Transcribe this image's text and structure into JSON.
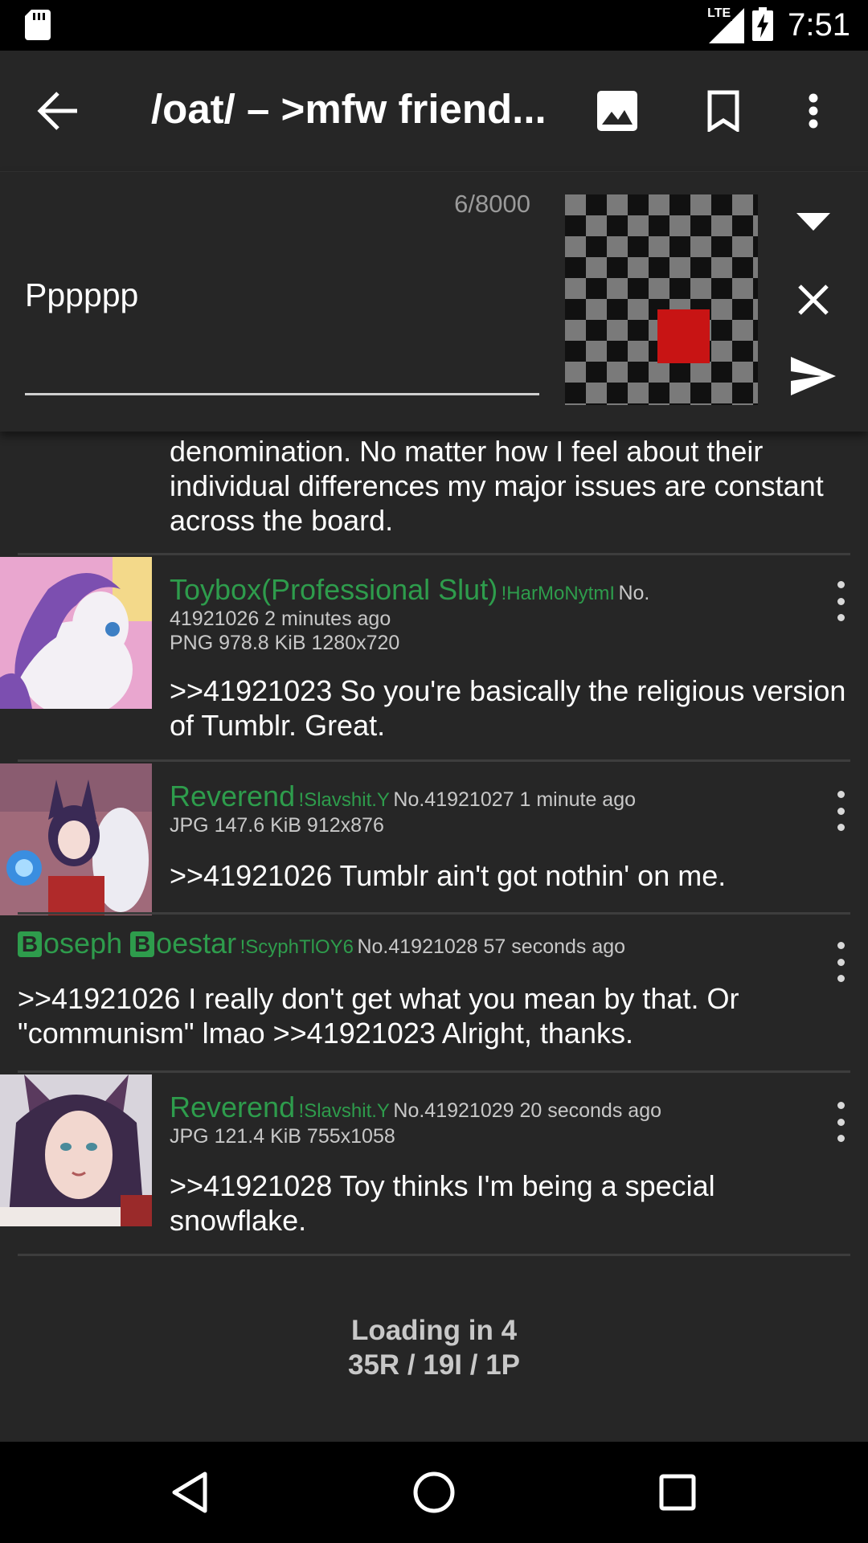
{
  "status_bar": {
    "time": "7:51",
    "network": "LTE",
    "icons": [
      "sd-card-icon",
      "signal-icon",
      "battery-charging-icon"
    ]
  },
  "toolbar": {
    "title": "/oat/ – >mfw friend...",
    "icons": [
      "back-arrow-icon",
      "image-icon",
      "bookmark-icon",
      "more-vert-icon"
    ]
  },
  "reply": {
    "char_count": "6/8000",
    "input_value": "Pppppp",
    "preview_colors": {
      "checker_dark": "#111111",
      "checker_light": "#7a7a7a",
      "square": "#c81414"
    },
    "icons": [
      "chevron-down-icon",
      "close-icon",
      "send-icon"
    ]
  },
  "posts": {
    "continued_text": "denomination. No matter how I feel about their individual differences my major issues are constant across the board.",
    "items": [
      {
        "name": "Toybox(Professional Slut)",
        "trip": "!HarMoNytmI",
        "meta_inline": "No.",
        "meta_line1": "41921026 2 minutes ago",
        "file_info": "PNG 978.8 KiB 1280x720",
        "comment": ">>41921023 So you're basically the religious version of Tumblr. Great."
      },
      {
        "name": "Reverend",
        "trip": "!Slavshit.Y",
        "meta_inline": "No.41921027 1 minute ago",
        "file_info": "JPG 147.6 KiB 912x876",
        "comment": ">>41921026 Tumblr ain't got nothin' on me."
      },
      {
        "name_first_letter": "B",
        "name_part1": "oseph ",
        "name_second_letter": "B",
        "name_part2": "oestar",
        "trip": "!ScyphTlOY6",
        "meta_inline": "No.41921028 57 seconds ago",
        "comment": ">>41921026 I really don't get what you mean by that. Or \"communism\" lmao >>41921023 Alright, thanks."
      },
      {
        "name": "Reverend",
        "trip": "!Slavshit.Y",
        "meta_inline": "No.41921029 20 seconds ago",
        "file_info": "JPG 121.4 KiB 755x1058",
        "comment": ">>41921028 Toy thinks I'm being a special snowflake."
      }
    ]
  },
  "footer": {
    "loading": "Loading in 4",
    "counts": "35R / 19I / 1P"
  },
  "nav_bar": {
    "icons": [
      "nav-back-icon",
      "nav-home-icon",
      "nav-recents-icon"
    ]
  },
  "colors": {
    "background": "#262626",
    "poster_name": "#2e9c4c",
    "text": "#ffffff",
    "meta": "#c8c8c8"
  }
}
